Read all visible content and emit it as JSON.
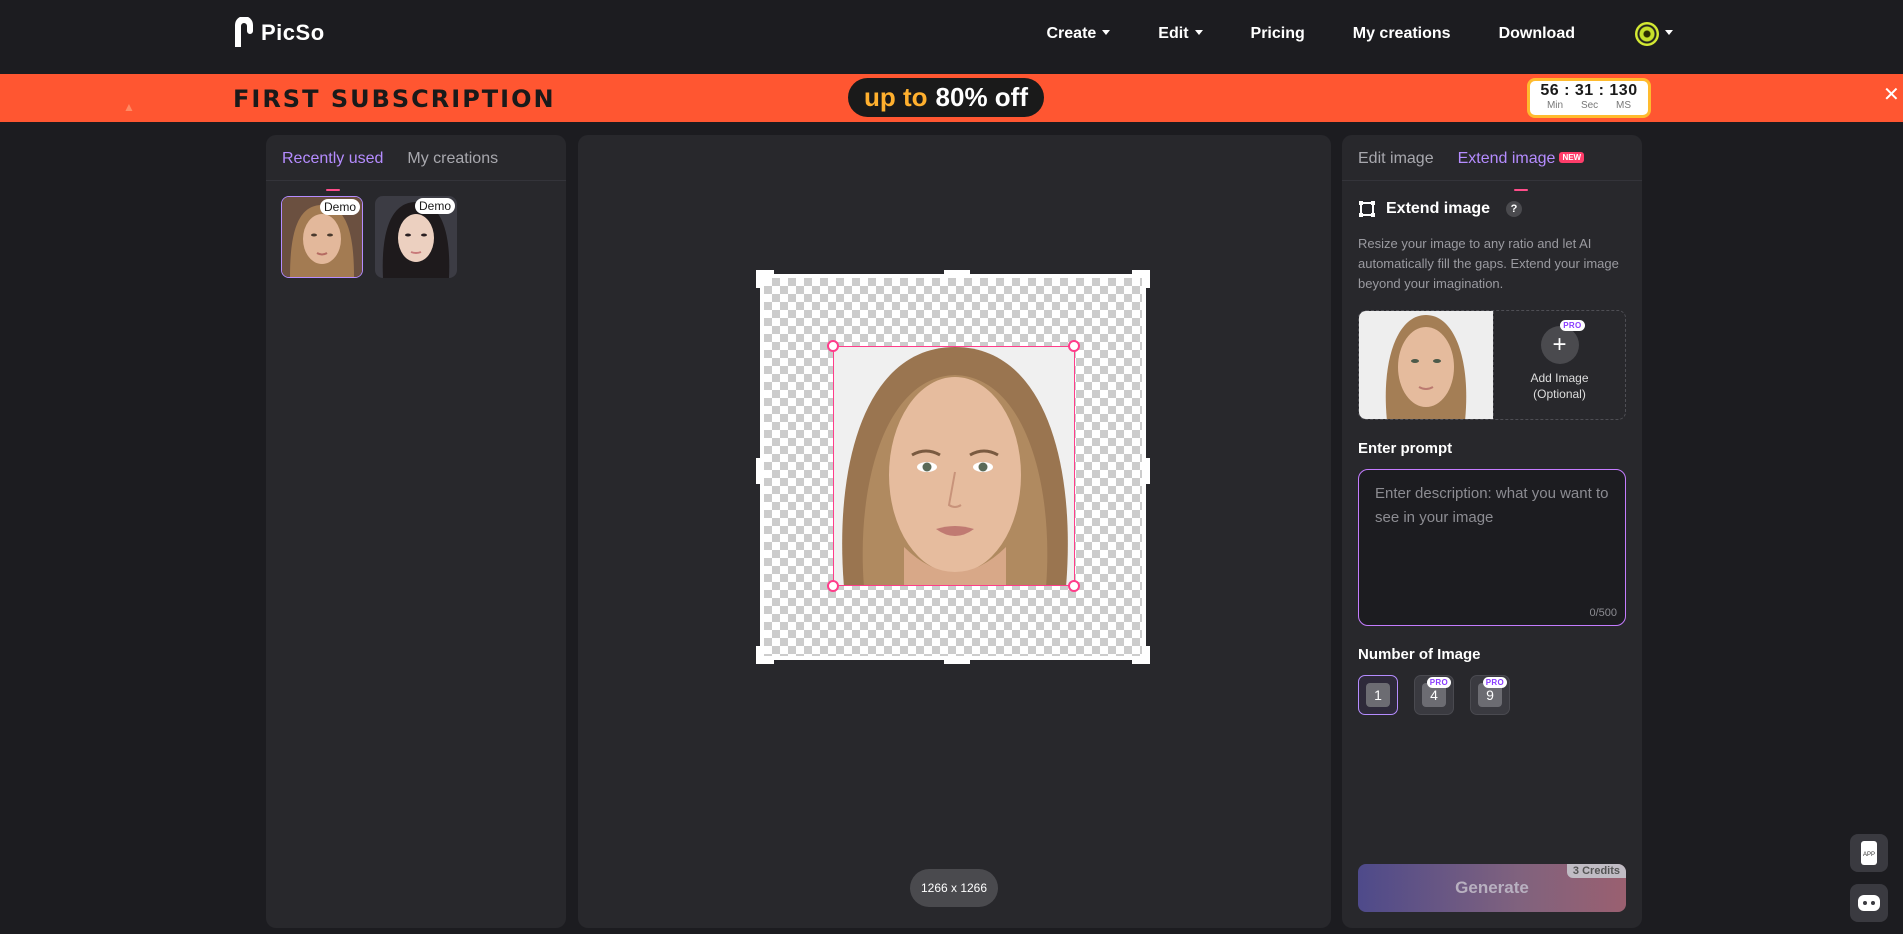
{
  "header": {
    "brand": "PicSo",
    "nav": [
      {
        "label": "Create",
        "has_caret": true
      },
      {
        "label": "Edit",
        "has_caret": true
      },
      {
        "label": "Pricing",
        "has_caret": false
      },
      {
        "label": "My creations",
        "has_caret": false
      },
      {
        "label": "Download",
        "has_caret": false
      }
    ]
  },
  "banner": {
    "title": "FIRST SUBSCRIPTION",
    "offer_prefix": "up to",
    "offer_value": "80% off",
    "timer": {
      "min": "56",
      "sec": "31",
      "ms": "130",
      "min_label": "Min",
      "sec_label": "Sec",
      "ms_label": "MS"
    },
    "close_icon": "close-icon",
    "bg_color": "#ff5631"
  },
  "left_panel": {
    "tabs": [
      {
        "label": "Recently used",
        "active": true
      },
      {
        "label": "My creations",
        "active": false
      }
    ],
    "thumbs": [
      {
        "badge": "Demo",
        "selected": true
      },
      {
        "badge": "Demo",
        "selected": false
      }
    ]
  },
  "canvas": {
    "size_label": "1266 x 1266"
  },
  "right_panel": {
    "tabs": [
      {
        "label": "Edit image",
        "active": false
      },
      {
        "label": "Extend image",
        "active": true,
        "badge": "NEW"
      }
    ],
    "section_title": "Extend image",
    "help_icon": "?",
    "description": "Resize your image to any ratio and let AI automatically fill the gaps. Extend your image beyond your imagination.",
    "add_image_label_1": "Add Image",
    "add_image_label_2": "(Optional)",
    "pro_badge": "PRO",
    "prompt_label": "Enter prompt",
    "prompt_placeholder": "Enter description: what you want to see in your image",
    "prompt_counter": "0/500",
    "num_label": "Number of Image",
    "num_options": [
      "1",
      "4",
      "9"
    ],
    "generate_label": "Generate",
    "credits": "3 Credits"
  },
  "float": {
    "app_label": "APP"
  },
  "colors": {
    "accent": "#b58cff",
    "pink": "#ff3d8a",
    "bg": "#1c1c20",
    "panel": "#28282c"
  }
}
